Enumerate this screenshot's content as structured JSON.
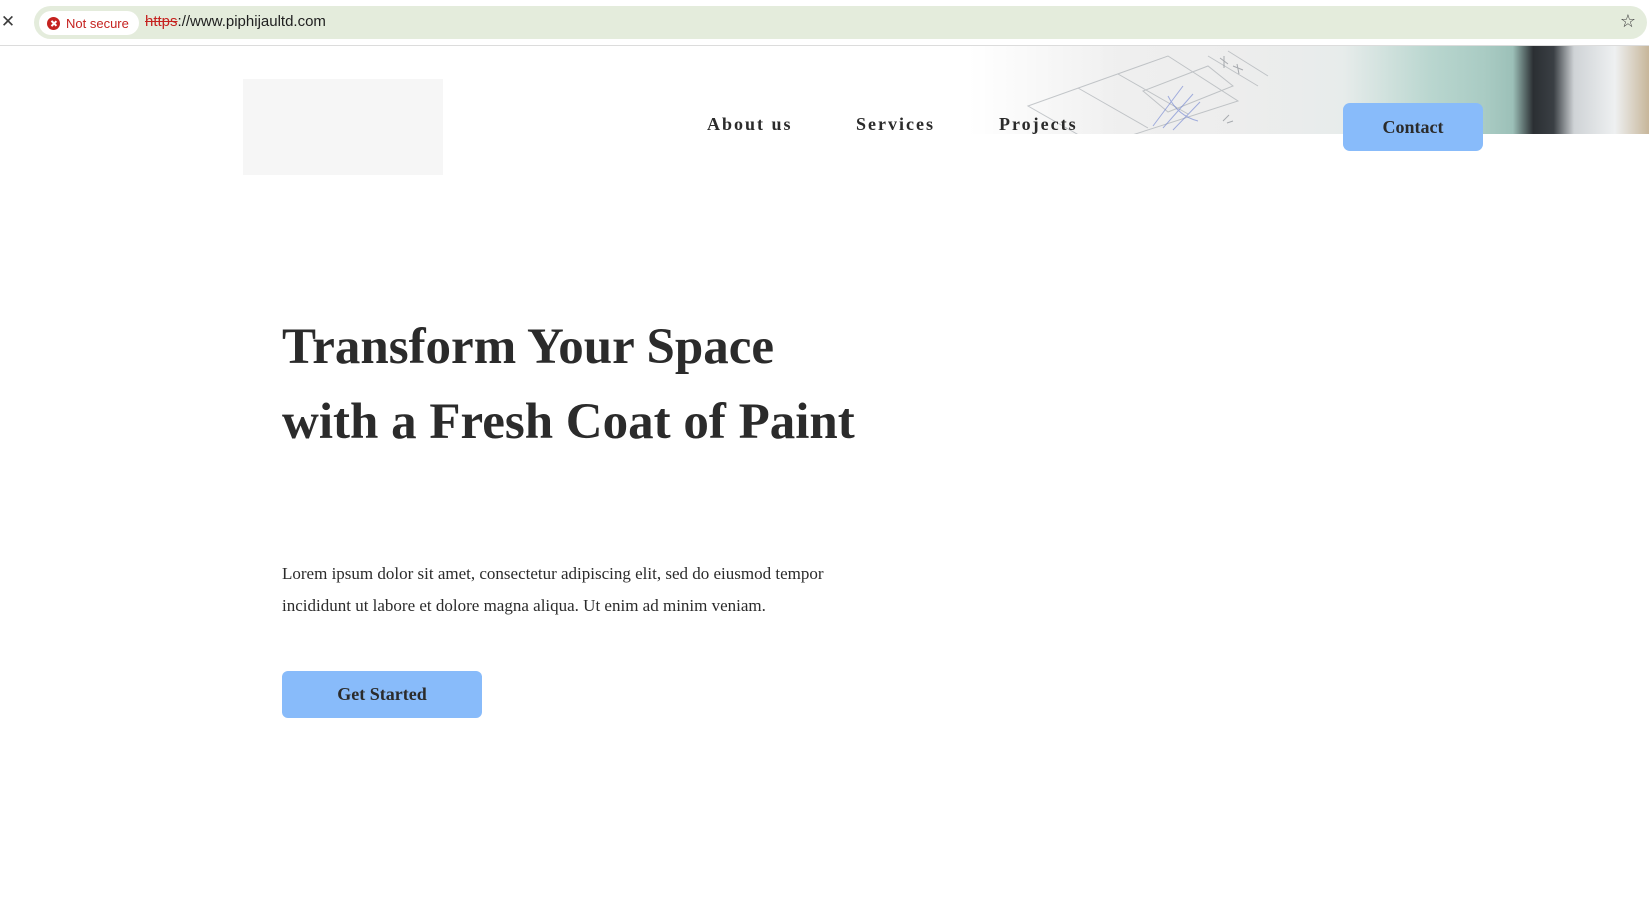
{
  "browser": {
    "security_label": "Not secure",
    "url_scheme": "https",
    "url_rest": "://www.piphijaultd.com",
    "close_icon": "close-icon",
    "bookmark_icon": "star-icon",
    "warning_icon": "not-secure-icon",
    "omnibox_color": "#e4ecdc",
    "warning_color": "#c5221f"
  },
  "header": {
    "nav": {
      "about": "About us",
      "services": "Services",
      "projects": "Projects"
    },
    "contact_label": "Contact",
    "accent_color": "#88bbfa"
  },
  "hero": {
    "title": "Transform Your Space with a Fresh Coat of Paint",
    "text": "Lorem ipsum dolor sit amet, consectetur adipiscing elit, sed do eiusmod tempor incididunt ut labore et dolore magna aliqua. Ut enim ad minim veniam.",
    "cta_label": "Get Started"
  }
}
